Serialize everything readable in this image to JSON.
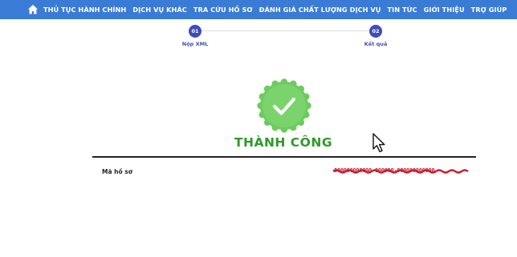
{
  "nav": {
    "items": [
      "THỦ TỤC HÀNH CHÍNH",
      "DỊCH VỤ KHÁC",
      "TRA CỨU HỒ SƠ",
      "ĐÁNH GIÁ CHẤT LƯỢNG DỊCH VỤ",
      "TIN TỨC",
      "GIỚI THIỆU",
      "TRỢ GIÚP"
    ],
    "home_icon": "home-icon"
  },
  "stepper": {
    "steps": [
      {
        "number": "01",
        "label": "Nộp XML"
      },
      {
        "number": "02",
        "label": "Kết quả"
      }
    ]
  },
  "result": {
    "status_icon": "check-badge-icon",
    "title": "THÀNH CÔNG",
    "record_label": "Mã hồ sơ",
    "record_value": "000000000000-000000-000000000000"
  },
  "colors": {
    "navbar": "#3a7bd5",
    "step": "#3f4db8",
    "success": "#2e9a2a",
    "badge": "#6ccb5f",
    "redaction": "#c71c2e"
  }
}
